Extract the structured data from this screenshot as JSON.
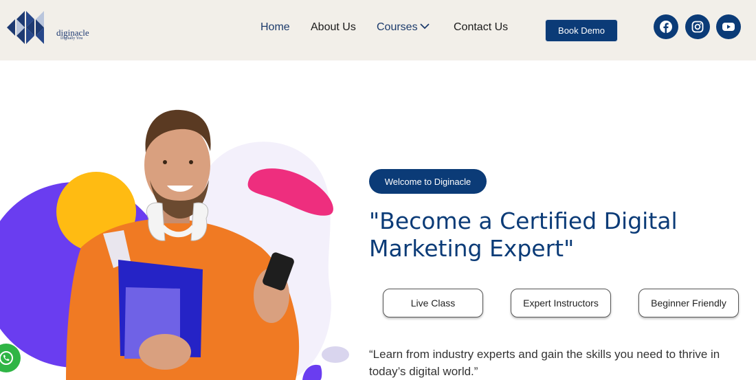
{
  "brand": {
    "name": "diginacle",
    "tagline": "Digitally You"
  },
  "nav": {
    "items": [
      {
        "label": "Home"
      },
      {
        "label": "About Us"
      },
      {
        "label": "Courses"
      },
      {
        "label": "Contact Us"
      }
    ],
    "book_demo_label": "Book Demo"
  },
  "social": [
    "facebook-icon",
    "instagram-icon",
    "youtube-icon"
  ],
  "hero": {
    "welcome_label": "Welcome to Diginacle",
    "headline_line1": "\"Become a Certified Digital",
    "headline_line2": "Marketing Expert\"",
    "features": [
      "Live Class",
      "Expert Instructors",
      "Beginner Friendly"
    ],
    "quote_line1": "“Learn from industry experts and gain the skills you need to thrive in",
    "quote_line2": "today’s digital world.”"
  },
  "colors": {
    "header_bg": "#f2efe9",
    "brand_navy": "#0b3b77",
    "purple": "#6a3df0",
    "yellow": "#ffbb12",
    "pink": "#ee2e7e",
    "orange": "#f07a23",
    "whatsapp_green": "#2fb545"
  }
}
